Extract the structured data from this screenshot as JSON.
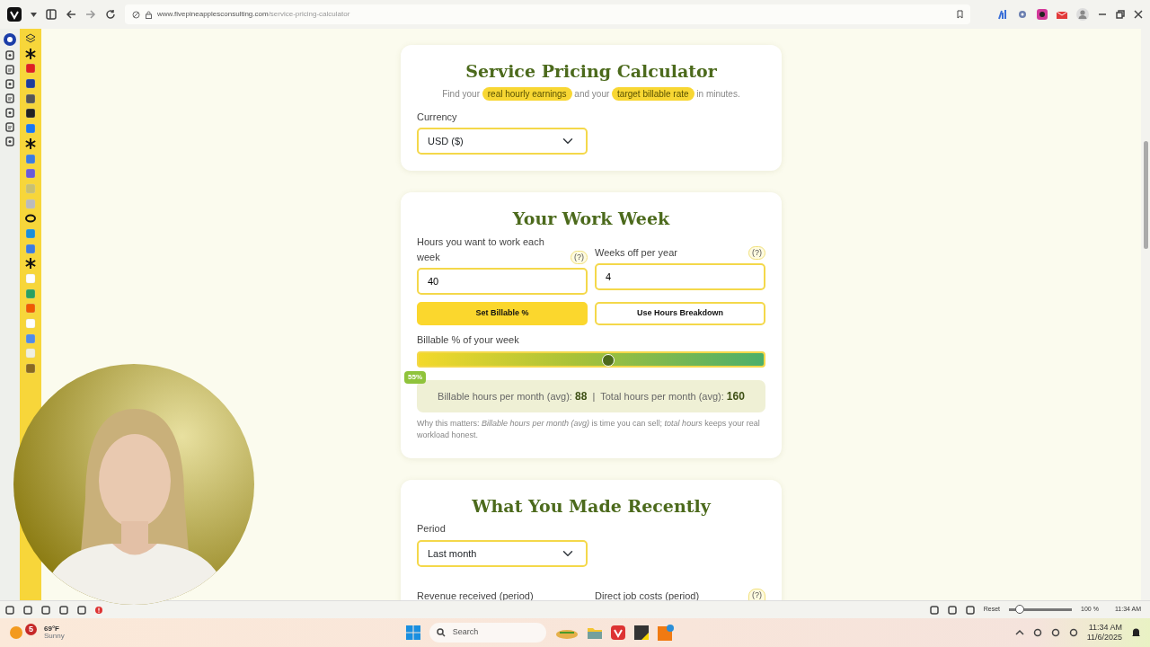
{
  "browser": {
    "url_host": "www.fivepineapplesconsulting.com",
    "url_path": "/service-pricing-calculator"
  },
  "intro_card": {
    "title": "Service Pricing Calculator",
    "subtitle": [
      {
        "text": "Find your",
        "highlight": false
      },
      {
        "text": "real hourly earnings",
        "highlight": true
      },
      {
        "text": "and your",
        "highlight": false
      },
      {
        "text": "target billable rate",
        "highlight": true
      },
      {
        "text": "in minutes.",
        "highlight": false
      }
    ],
    "currency": {
      "label": "Currency",
      "value": "USD ($)"
    }
  },
  "work_week": {
    "title": "Your Work Week",
    "fields": [
      {
        "label": "Hours you want to work each week",
        "help": "(?)",
        "value": "40"
      },
      {
        "label": "Weeks off per year",
        "help": "(?)",
        "value": "4"
      }
    ],
    "modes": [
      {
        "label": "Set Billable %",
        "selected": true
      },
      {
        "label": "Use Hours Breakdown",
        "selected": false
      }
    ],
    "slider": {
      "label": "Billable % of your week",
      "level": 0.55,
      "reading": "55%"
    },
    "summary": [
      {
        "label": "Billable hours per month (avg):",
        "value": "88"
      },
      {
        "label": "Total hours per month (avg):",
        "value": "160"
      }
    ],
    "separator": "|",
    "note": "Why this matters: *Billable hours per month (avg)* is time you can sell; *total hours* keeps your real workload honest."
  },
  "recent": {
    "title": "What You Made Recently",
    "period": {
      "label": "Period",
      "value": "Last month"
    },
    "fields": [
      {
        "label": "Revenue received (period)"
      },
      {
        "label": "Direct job costs (period)",
        "help": "(?)"
      }
    ]
  },
  "status_bar": {
    "reset": "Reset",
    "zoom": {
      "level": 0.17,
      "reading": "100 %"
    },
    "time": "11:34 AM"
  },
  "taskbar": {
    "weather": {
      "badge": "5",
      "temp": "69°F",
      "condition": "Sunny"
    },
    "search_placeholder": "Search",
    "time": "11:34 AM",
    "date": "11/6/2025"
  }
}
